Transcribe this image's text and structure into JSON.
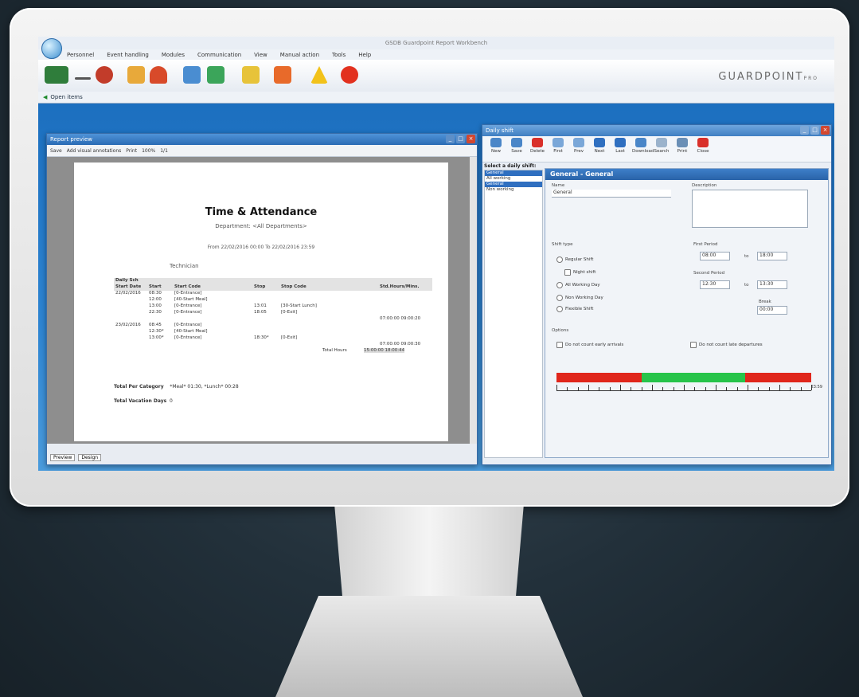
{
  "app": {
    "title": "GSDB Guardpoint Report Workbench",
    "brand": "GUARDPOINT",
    "brand_suffix": "PRO",
    "menu": [
      "Personnel",
      "Event handling",
      "Modules",
      "Communication",
      "View",
      "Manual action",
      "Tools",
      "Help"
    ],
    "open_items": "Open items"
  },
  "preview": {
    "title": "Report preview",
    "toolbar": [
      "Save",
      "Add visual annotations",
      "Print",
      "100%",
      "1/1"
    ],
    "report_title": "Time & Attendance",
    "department": "Department: <All Departments>",
    "range": "From 22/02/2016 00:00  To 22/02/2016 23:59",
    "group": "Technician",
    "columns": [
      "Start Date",
      "Start",
      "Start Code",
      "Stop",
      "Stop Code",
      "Std.Hours/Mins."
    ],
    "section_label": "Daily Sch",
    "rows": [
      {
        "date": "22/02/2016",
        "start": "08:30",
        "code": "[0-Entrance]",
        "stop": "",
        "stop_code": "",
        "hours": ""
      },
      {
        "date": "",
        "start": "12:00",
        "code": "[40-Start Meal]",
        "stop": "",
        "stop_code": "",
        "hours": ""
      },
      {
        "date": "",
        "start": "13:00",
        "code": "[0-Entrance]",
        "stop": "13:01",
        "stop_code": "[30-Start Lunch]",
        "hours": ""
      },
      {
        "date": "",
        "start": "22:30",
        "code": "[0-Entrance]",
        "stop": "18:05",
        "stop_code": "[0-Exit]",
        "hours": ""
      },
      {
        "date": "",
        "start": "",
        "code": "",
        "stop": "",
        "stop_code": "",
        "hours": "07:00:00 09:00:20"
      },
      {
        "date": "23/02/2016",
        "start": "08:45",
        "code": "[0-Entrance]",
        "stop": "",
        "stop_code": "",
        "hours": ""
      },
      {
        "date": "",
        "start": "12:30*",
        "code": "[40-Start Meal]",
        "stop": "",
        "stop_code": "",
        "hours": ""
      },
      {
        "date": "",
        "start": "13:00*",
        "code": "[0-Entrance]",
        "stop": "18:30*",
        "stop_code": "[0-Exit]",
        "hours": ""
      },
      {
        "date": "",
        "start": "",
        "code": "",
        "stop": "",
        "stop_code": "",
        "hours": "07:00:00 09:00:30"
      }
    ],
    "total_hours_label": "Total Hours",
    "total_hours_value": "15:00:00 18:00:44",
    "total_category_label": "Total Per Category",
    "total_category_value": "*Meal* 01:30, *Lunch* 00:28",
    "vacation_label": "Total Vacation Days",
    "vacation_value": "0",
    "tabs": [
      "Preview",
      "Design"
    ]
  },
  "shift": {
    "window_title": "Daily shift",
    "tools": [
      "New",
      "Save",
      "Delete",
      "First",
      "Prev",
      "Next",
      "Last",
      "Download",
      "Search",
      "Print",
      "Close"
    ],
    "select_label": "Select a daily shift:",
    "list": [
      "General",
      "All working",
      "General",
      "Non working"
    ],
    "selected_index": 2,
    "panel_title": "General - General",
    "name_label": "Name",
    "name_value": "General",
    "desc_label": "Description",
    "shift_type_label": "Shift type",
    "types": [
      "Regular Shift",
      "Night shift",
      "All Working Day",
      "Non Working Day",
      "Flexible Shift"
    ],
    "first_period_label": "First Period",
    "first_from": "08:00",
    "first_to": "18:00",
    "second_period_label": "Second Period",
    "second_from": "12:30",
    "second_to": "13:30",
    "to_label": "to",
    "break_label": "Break",
    "break_value": "00:00",
    "options_label": "Options",
    "opt_early": "Do not count early arrivals",
    "opt_late": "Do not count late departures",
    "ruler_end": "23:59"
  },
  "colors": {
    "accent": "#2a6bb4",
    "bar_red": "#e0261b",
    "bar_green": "#27c44a"
  }
}
